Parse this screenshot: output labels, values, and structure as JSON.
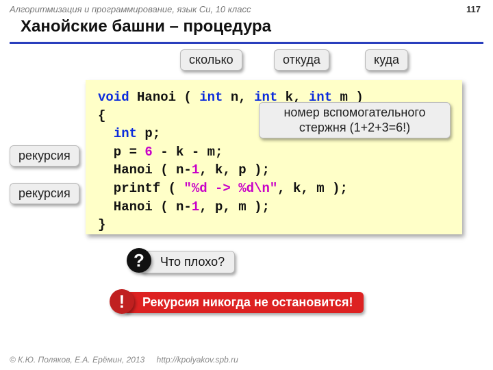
{
  "header": {
    "breadcrumb": "Алгоритмизация и программирование, язык Си, 10 класс",
    "page_number": "117"
  },
  "title": "Ханойские башни – процедура",
  "labels": {
    "howmany": "сколько",
    "from": "откуда",
    "to": "куда",
    "aux": "номер вспомогательного стержня (1+2+3=6!)",
    "recursion1": "рекурсия",
    "recursion2": "рекурсия"
  },
  "code": {
    "l1a": "void",
    "l1b": " Hanoi ( ",
    "l1c": "int",
    "l1d": " n, ",
    "l1e": "int",
    "l1f": " k, ",
    "l1g": "int",
    "l1h": " m )",
    "l2": "{",
    "l3a": "  ",
    "l3b": "int",
    "l3c": " p;",
    "l4a": "  p = ",
    "l4b": "6",
    "l4c": " - k - m;",
    "l5a": "  Hanoi ( n-",
    "l5b": "1",
    "l5c": ", k, p );",
    "l6a": "  printf ( ",
    "l6b": "\"%d -> %d\\n\"",
    "l6c": ", k, m );",
    "l7a": "  Hanoi ( n-",
    "l7b": "1",
    "l7c": ", p, m );",
    "l8": "}"
  },
  "question": {
    "badge": "?",
    "text": "Что плохо?"
  },
  "alert": {
    "badge": "!",
    "text": "Рекурсия никогда не остановится!"
  },
  "footer": {
    "copyright": "© К.Ю. Поляков, Е.А. Ерёмин, 2013",
    "url": "http://kpolyakov.spb.ru"
  }
}
